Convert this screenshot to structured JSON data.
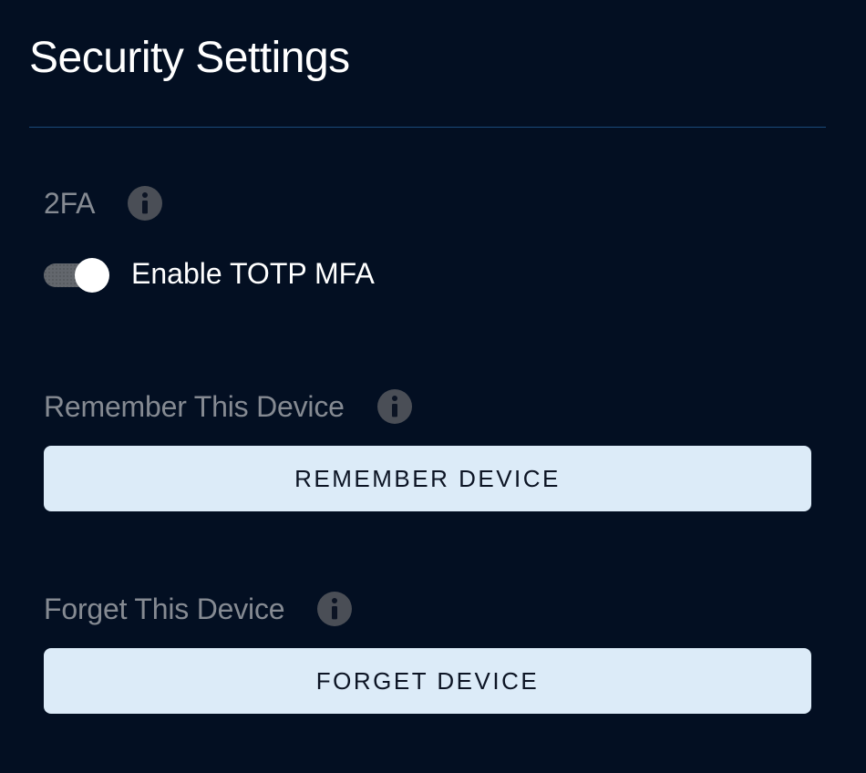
{
  "page": {
    "title": "Security Settings"
  },
  "sections": {
    "twofa": {
      "label": "2FA",
      "toggle_label": "Enable TOTP MFA",
      "toggle_state": "on"
    },
    "remember": {
      "label": "Remember This Device",
      "button": "REMEMBER DEVICE"
    },
    "forget": {
      "label": "Forget This Device",
      "button": "FORGET DEVICE"
    }
  }
}
